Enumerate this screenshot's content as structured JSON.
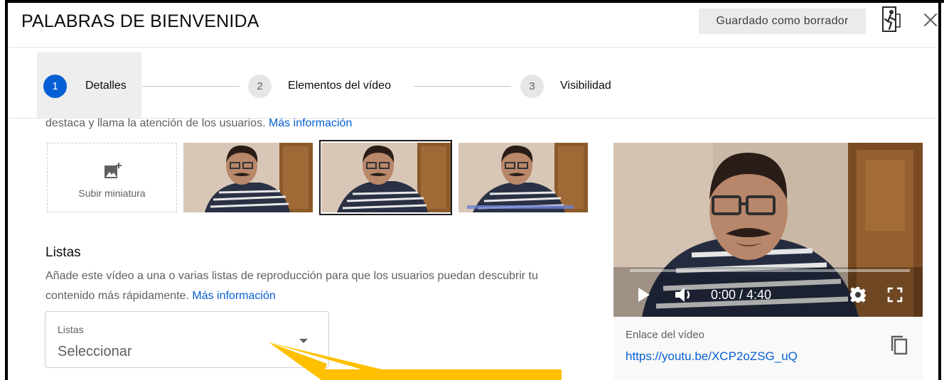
{
  "header": {
    "title": "PALABRAS DE BIENVENIDA",
    "draft_status": "Guardado como borrador"
  },
  "stepper": {
    "steps": [
      {
        "number": "1",
        "label": "Detalles",
        "active": true
      },
      {
        "number": "2",
        "label": "Elementos del vídeo",
        "active": false
      },
      {
        "number": "3",
        "label": "Visibilidad",
        "active": false
      }
    ]
  },
  "thumbnail": {
    "description": "destaca y llama la atención de los usuarios.",
    "more_info": "Más información",
    "upload_label": "Subir miniatura",
    "selected_index": 1
  },
  "playlists": {
    "heading": "Listas",
    "description": "Añade este vídeo a una o varias listas de reproducción para que los usuarios puedan descubrir tu contenido más rápidamente.",
    "more_info": "Más información",
    "field_label": "Listas",
    "field_value": "Seleccionar"
  },
  "video": {
    "time": "0:00 / 4:40",
    "progress": 0.0,
    "link_label": "Enlace del vídeo",
    "link_url": "https://youtu.be/XCP2oZSG_uQ"
  },
  "colors": {
    "accent_blue": "#065fd4",
    "annotation_yellow": "#ffc000"
  },
  "icons": [
    "exit-icon",
    "close-icon",
    "add-photo-icon",
    "play-icon",
    "volume-icon",
    "gear-icon",
    "fullscreen-icon",
    "copy-icon",
    "chevron-down-icon"
  ]
}
